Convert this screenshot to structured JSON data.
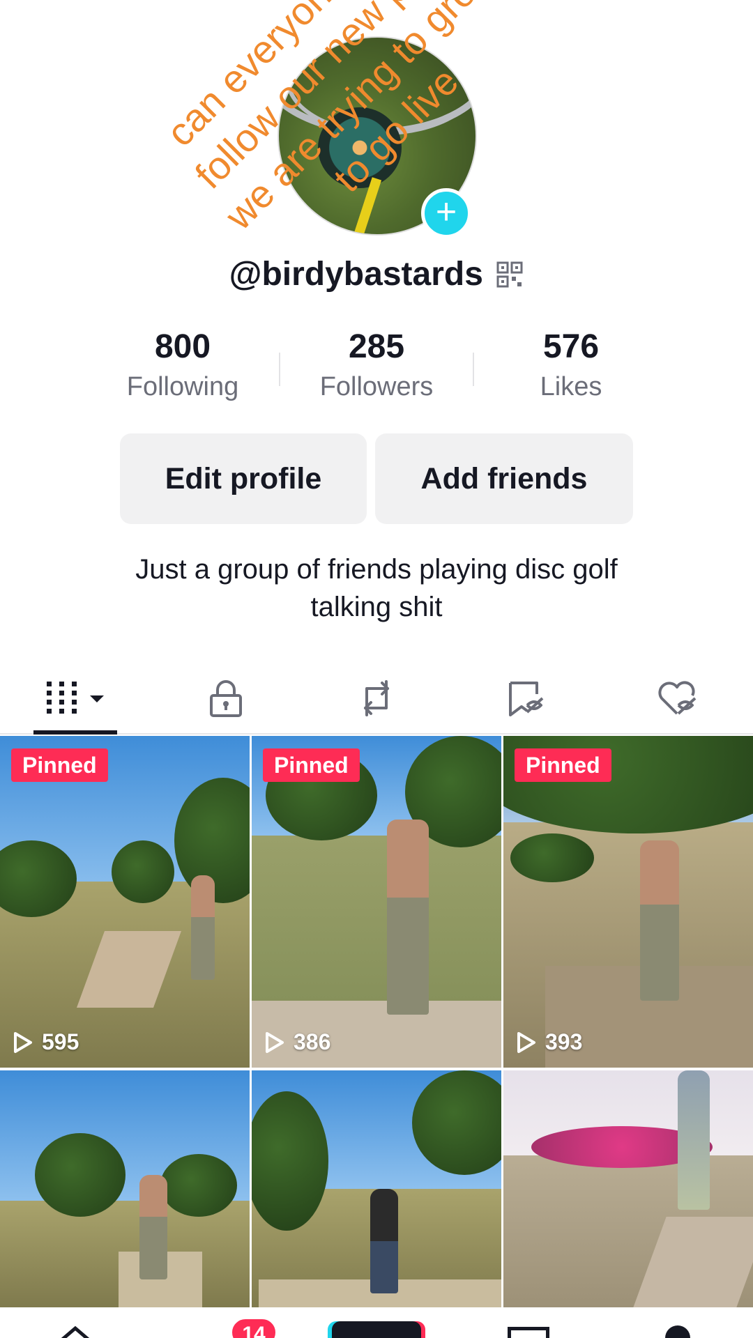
{
  "profile": {
    "username": "@birdybastards",
    "bio_line1": "Just a group of friends playing disc golf",
    "bio_line2": "talking shit"
  },
  "stats": {
    "following": {
      "value": "800",
      "label": "Following"
    },
    "followers": {
      "value": "285",
      "label": "Followers"
    },
    "likes": {
      "value": "576",
      "label": "Likes"
    }
  },
  "buttons": {
    "edit_profile": "Edit profile",
    "add_friends": "Add friends"
  },
  "tabs": [
    {
      "name": "videos",
      "icon": "grid-icon",
      "selected": true
    },
    {
      "name": "private",
      "icon": "lock-icon"
    },
    {
      "name": "reposts",
      "icon": "repost-icon"
    },
    {
      "name": "favorites",
      "icon": "bookmark-hidden-icon"
    },
    {
      "name": "liked",
      "icon": "heart-hidden-icon"
    }
  ],
  "videos": [
    {
      "pinned_label": "Pinned",
      "views": "595"
    },
    {
      "pinned_label": "Pinned",
      "views": "386"
    },
    {
      "pinned_label": "Pinned",
      "views": "393"
    },
    {},
    {},
    {}
  ],
  "overlay": {
    "line1": "can everyone plz g",
    "line2": "follow our new page",
    "line3": "we are trying to grow",
    "line4": "to go live"
  },
  "bottom_nav": {
    "inbox_badge": "14"
  },
  "colors": {
    "accent": "#fe2c55",
    "avatar_add": "#20d5ec",
    "overlay_text": "#f08a2e"
  }
}
